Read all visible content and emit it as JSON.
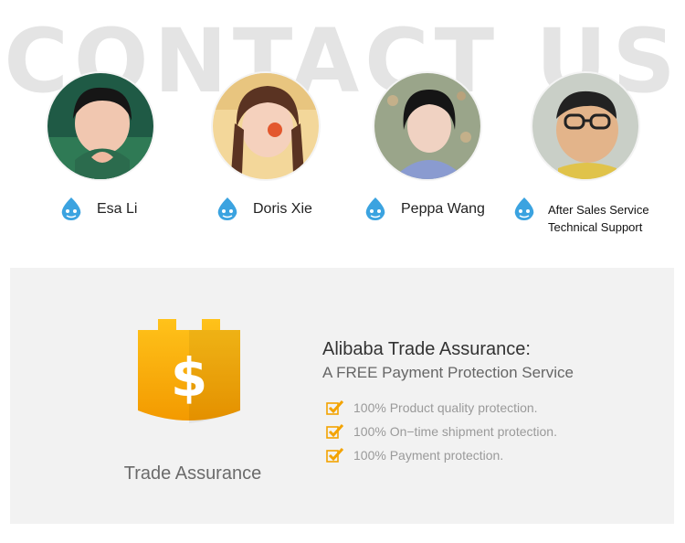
{
  "heading": {
    "background_text": "CONTACT US"
  },
  "contacts": [
    {
      "name": "Esa Li",
      "avatar": "person-avatar"
    },
    {
      "name": "Doris Xie",
      "avatar": "person-avatar"
    },
    {
      "name": "Peppa Wang",
      "avatar": "person-avatar"
    },
    {
      "name_lines": [
        "After Sales Service",
        "Technical Support"
      ],
      "avatar": "cartoon-avatar"
    }
  ],
  "trade_assurance": {
    "badge_caption": "Trade Assurance",
    "title": "Alibaba Trade Assurance:",
    "subtitle": "A FREE Payment Protection Service",
    "features": [
      "100% Product quality protection.",
      "100% On−time shipment protection.",
      "100% Payment protection."
    ]
  },
  "colors": {
    "accent": "#f7a800",
    "chat_icon": "#3ba3e0",
    "panel_bg": "#f2f2f2"
  },
  "icons": {
    "chat": "chat-drop-icon",
    "check": "check-icon",
    "badge": "shield-dollar-icon"
  }
}
